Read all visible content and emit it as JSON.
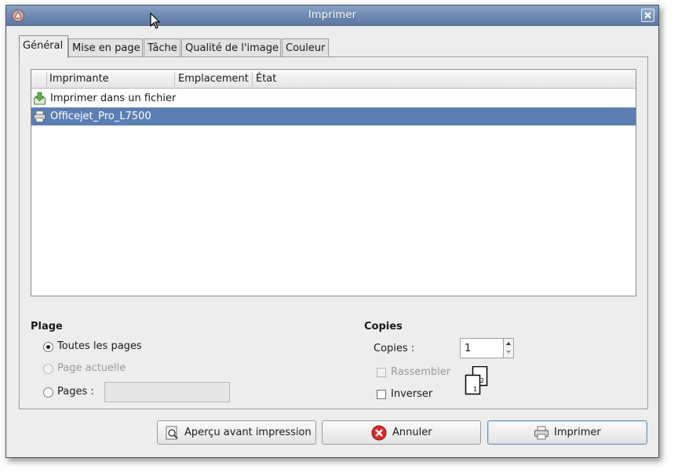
{
  "window": {
    "title": "Imprimer"
  },
  "tabs": [
    {
      "label": "Général"
    },
    {
      "label": "Mise en page"
    },
    {
      "label": "Tâche"
    },
    {
      "label": "Qualité de l'image"
    },
    {
      "label": "Couleur"
    }
  ],
  "printer_list": {
    "columns": [
      "Imprimante",
      "Emplacement",
      "État"
    ],
    "rows": [
      {
        "name": "Imprimer dans un fichier",
        "icon": "save-to-file-icon",
        "selected": false
      },
      {
        "name": "Officejet_Pro_L7500",
        "icon": "printer-icon",
        "selected": true
      }
    ]
  },
  "range": {
    "title": "Plage",
    "options": [
      {
        "label": "Toutes les pages",
        "checked": true,
        "enabled": true
      },
      {
        "label": "Page actuelle",
        "checked": false,
        "enabled": false
      },
      {
        "label": "Pages :",
        "checked": false,
        "enabled": true
      }
    ],
    "pages_value": ""
  },
  "copies": {
    "title": "Copies",
    "count_label": "Copies :",
    "count_value": "1",
    "collate_label": "Rassembler",
    "collate_checked": false,
    "collate_enabled": false,
    "reverse_label": "Inverser",
    "reverse_checked": false
  },
  "buttons": {
    "preview": "Aperçu avant impression",
    "cancel": "Annuler",
    "print": "Imprimer"
  },
  "colors": {
    "selection": "#5c7fb3",
    "titlebar": "#6f8bb3",
    "cancel_red": "#d92b2b"
  }
}
